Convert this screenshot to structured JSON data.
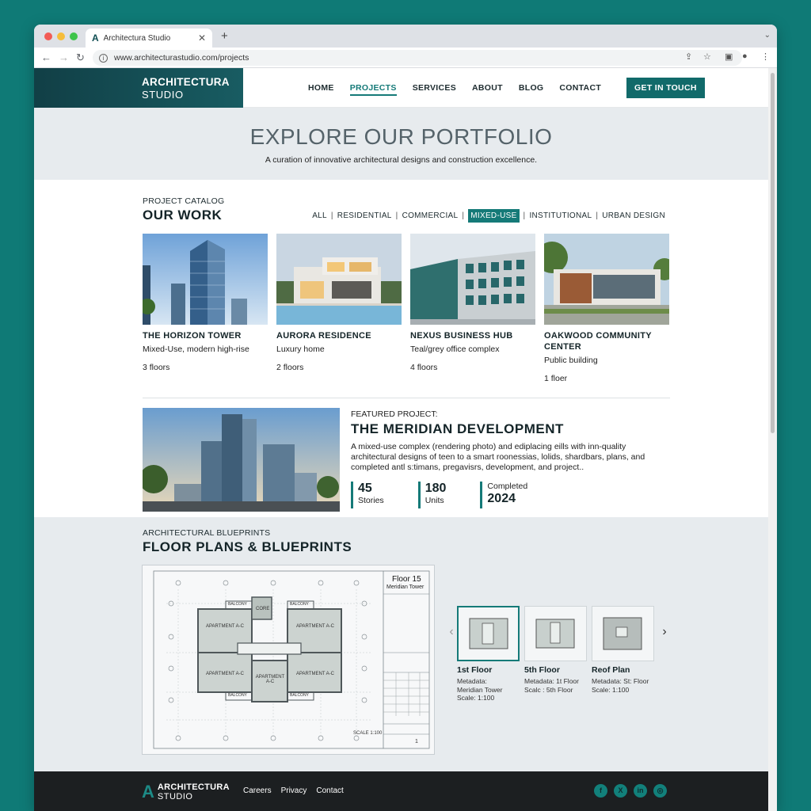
{
  "browser": {
    "tab_title": "Architectura Studio",
    "tab_favicon": "A",
    "url": "www.architecturastudio.com/projects"
  },
  "site": {
    "logo_line1": "ARCHITECTURA",
    "logo_line2": "STUDIO",
    "nav": [
      "HOME",
      "PROJECTS",
      "SERVICES",
      "ABOUT",
      "BLOG",
      "CONTACT"
    ],
    "active_nav": "PROJECTS",
    "cta": "GET IN TOUCH"
  },
  "hero": {
    "title": "EXPLORE OUR PORTFOLIO",
    "subtitle": "A curation of innovative architectural designs and construction excellence."
  },
  "catalog": {
    "eyebrow": "PROJECT CATALOG",
    "title": "OUR WORK",
    "filters": [
      "ALL",
      "RESIDENTIAL",
      "COMMERCIAL",
      "MIXED-USE",
      "INSTITUTIONAL",
      "URBAN DESIGN"
    ],
    "selected_filter": "MIXED-USE",
    "projects": [
      {
        "name": "THE HORIZON TOWER",
        "desc": "Mixed-Use, modern high-rise",
        "floors": "3 floors"
      },
      {
        "name": "AURORA RESIDENCE",
        "desc": "Luxury home",
        "floors": "2 floors"
      },
      {
        "name": "NEXUS BUSINESS HUB",
        "desc": "Teal/grey office complex",
        "floors": "4 floors"
      },
      {
        "name": "OAKWOOD COMMUNITY CENTER",
        "desc": "Public building",
        "floors": "1 floer"
      }
    ]
  },
  "featured": {
    "label": "FEATURED PROJECT:",
    "title": "THE MERIDIAN DEVELOPMENT",
    "desc": "A mixed-use complex (rendering photo) and ediplacing eills with inn-quality architectural designs of teen to a smart roonessias, lolids, shardbars, plans, and completed antl s:timans, pregavisrs, development, and project..",
    "stats": [
      {
        "value": "45",
        "label": "Stories"
      },
      {
        "value": "180",
        "label": "Units"
      },
      {
        "value": "2024",
        "label": "Completed"
      }
    ]
  },
  "blueprints": {
    "eyebrow": "ARCHITECTURAL BLUEPRINTS",
    "title": "FLOOR PLANS & BLUEPRINTS",
    "plan_title": "Floor 15",
    "plan_subtitle": "Meridian Tower",
    "plan_rooms": [
      "APARTMENT A-C",
      "CORE",
      "APARTMENT A-C",
      "APARTMENT A-C",
      "APARTMENT A-C",
      "APARTMENT A-C"
    ],
    "plan_balconies": [
      "BALCONY",
      "BALCONY",
      "BALCONY",
      "BALCONY"
    ],
    "plan_scale": "SCALE 1:100",
    "plan_sheet": "1",
    "thumbnails": [
      {
        "name": "1st Floor",
        "meta1": "Metadata:",
        "meta2": "Meridian Tower",
        "meta3": "Scale: 1:100"
      },
      {
        "name": "5th Floor",
        "meta1": "Metadata: 1t Floor",
        "meta2": "Scalc : 5th Floor",
        "meta3": ""
      },
      {
        "name": "Reof Plan",
        "meta1": "Metadata: St: Floor",
        "meta2": "Scale: 1:100",
        "meta3": ""
      }
    ],
    "selected_thumbnail": "1st Floor"
  },
  "footer": {
    "logo_line1": "ARCHITECTURA",
    "logo_line2": "STUDIO",
    "links": [
      "Careers",
      "Privacy",
      "Contact"
    ],
    "socials": [
      "facebook-icon",
      "x-icon",
      "linkedin-icon",
      "instagram-icon"
    ]
  },
  "colors": {
    "accent": "#157a78",
    "background": "#0f7a76",
    "footer": "#1c1f21"
  }
}
